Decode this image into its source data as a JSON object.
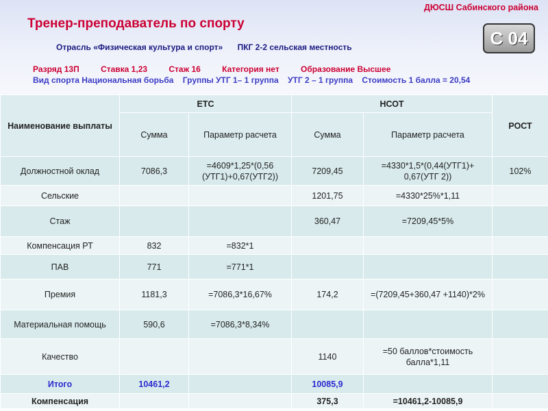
{
  "header": {
    "org": "ДЮСШ Сабинского района",
    "title": "Тренер-преподаватель по спорту",
    "code": "С 04",
    "branch": [
      "Отрасль «Физическая культура и спорт»",
      "ПКГ 2-2 сельская  местность"
    ],
    "params": [
      "Разряд 13П",
      "Ставка 1,23",
      "Стаж 16",
      "Категория нет",
      "Образование Высшее"
    ],
    "details": [
      "Вид спорта Национальная борьба",
      "Группы  УТГ 1– 1 группа",
      "УТГ 2 – 1 группа",
      "Стоимость 1 балла = 20,54"
    ]
  },
  "table": {
    "col_name": "Наименование выплаты",
    "group_ets": "ЕТС",
    "group_nsot": "НСОТ",
    "col_growth": "РОСТ",
    "sub_sum": "Сумма",
    "sub_param": "Параметр расчета",
    "rows": [
      {
        "name": "Должностной оклад",
        "ets_sum": "7086,3",
        "ets_param": "=4609*1,25*(0,56 (УТГ1)+0,67(УТГ2))",
        "nsot_sum": "7209,45",
        "nsot_param": "=4330*1,5*(0,44(УТГ1)+ 0,67(УТГ 2))",
        "growth": "102%"
      },
      {
        "name": "Сельские",
        "ets_sum": "",
        "ets_param": "",
        "nsot_sum": "1201,75",
        "nsot_param": "=4330*25%*1,11",
        "growth": ""
      },
      {
        "name": "Стаж",
        "ets_sum": "",
        "ets_param": "",
        "nsot_sum": "360,47",
        "nsot_param": "=7209,45*5%",
        "growth": ""
      },
      {
        "name": "Компенсация РТ",
        "ets_sum": "832",
        "ets_param": "=832*1",
        "nsot_sum": "",
        "nsot_param": "",
        "growth": ""
      },
      {
        "name": "ПАВ",
        "ets_sum": "771",
        "ets_param": "=771*1",
        "nsot_sum": "",
        "nsot_param": "",
        "growth": ""
      },
      {
        "name": "Премия",
        "ets_sum": "1181,3",
        "ets_param": "=7086,3*16,67%",
        "nsot_sum": "174,2",
        "nsot_param": "=(7209,45+360,47 +1140)*2%",
        "growth": ""
      },
      {
        "name": "Материальная помощь",
        "ets_sum": "590,6",
        "ets_param": "=7086,3*8,34%",
        "nsot_sum": "",
        "nsot_param": "",
        "growth": ""
      },
      {
        "name": "Качество",
        "ets_sum": "",
        "ets_param": "",
        "nsot_sum": "1140",
        "nsot_param": "=50 баллов*стоимость балла*1,11",
        "growth": ""
      }
    ],
    "total": {
      "name": "Итого",
      "ets_sum": "10461,2",
      "nsot_sum": "10085,9"
    },
    "compensation": {
      "name": "Компенсация",
      "nsot_sum": "375,3",
      "nsot_param": "=10461,2-10085,9"
    }
  }
}
